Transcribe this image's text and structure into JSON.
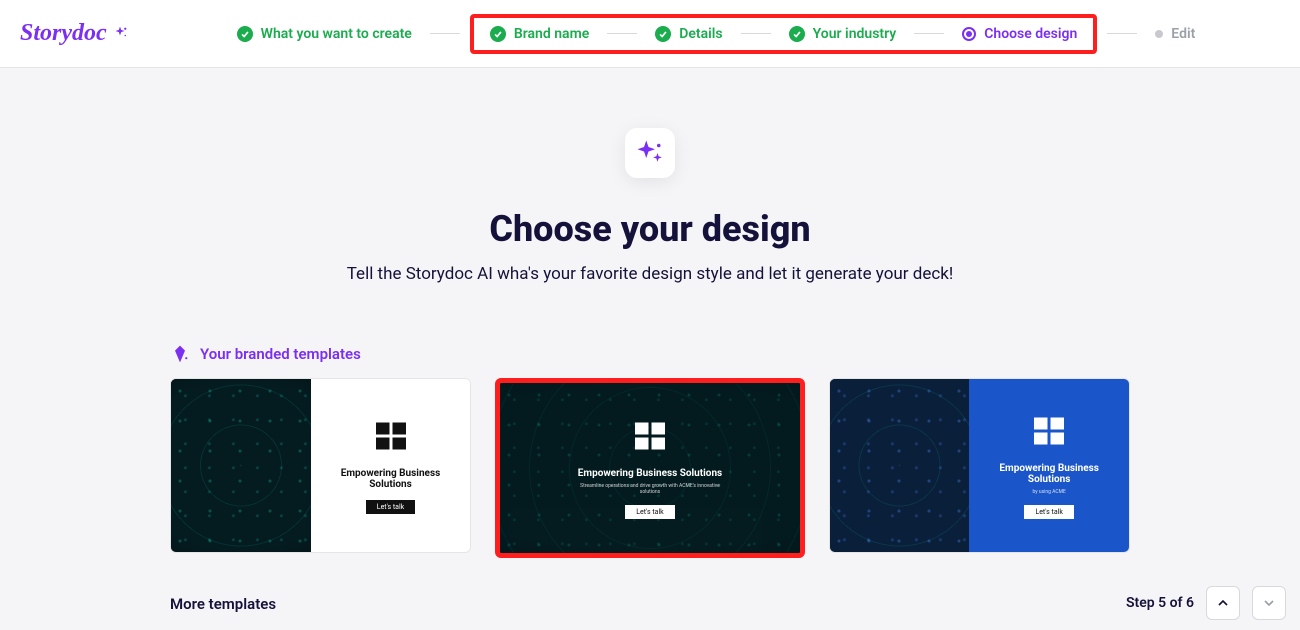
{
  "brand": {
    "name": "Storydoc"
  },
  "stepper": {
    "items": [
      {
        "label": "What you want to create",
        "state": "done"
      },
      {
        "label": "Brand name",
        "state": "done"
      },
      {
        "label": "Details",
        "state": "done"
      },
      {
        "label": "Your industry",
        "state": "done"
      },
      {
        "label": "Choose design",
        "state": "current"
      },
      {
        "label": "Edit",
        "state": "pending"
      }
    ]
  },
  "page": {
    "title": "Choose your design",
    "subtitle": "Tell the Storydoc AI wha's your favorite design style and let it generate your deck!"
  },
  "section_branded": {
    "label": "Your branded templates"
  },
  "templates": [
    {
      "title": "Empowering Business Solutions",
      "cta": "Let's talk",
      "layout": "split-white",
      "selected": false
    },
    {
      "title": "Empowering Business Solutions",
      "cta": "Let's talk",
      "layout": "full-dark",
      "selected": true
    },
    {
      "title": "Empowering Business Solutions",
      "cta": "Let's talk",
      "layout": "split-blue",
      "selected": false
    }
  ],
  "more_section": {
    "label": "More templates"
  },
  "footer": {
    "step_text": "Step 5 of 6"
  },
  "icons": {
    "sparkle": "sparkle-icon",
    "check": "check-icon",
    "diamond": "diamond-icon",
    "up": "arrow-up-icon",
    "down": "arrow-down-icon"
  }
}
